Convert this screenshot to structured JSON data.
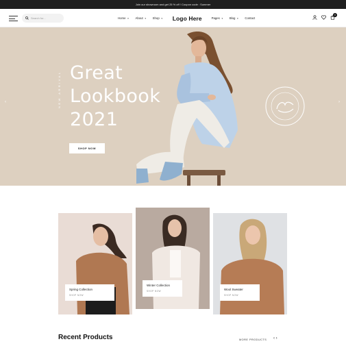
{
  "announcement": "Join our showroom and get 25 % off ! Coupon code : Summer",
  "header": {
    "search_placeholder": "Search for...",
    "nav": [
      {
        "label": "Home"
      },
      {
        "label": "About"
      },
      {
        "label": "Shop"
      },
      {
        "label": "Pages"
      },
      {
        "label": "Blog"
      },
      {
        "label": "Contact"
      }
    ],
    "logo": "Logo Here",
    "cart_count": "0",
    "icons": [
      "menu-icon",
      "search-icon",
      "user-icon",
      "heart-icon",
      "cart-icon"
    ]
  },
  "hero": {
    "title_line1": "Great",
    "title_line2": "Lookbook",
    "title_line3": "2021",
    "vertical_text": "NEW ARRIVAL",
    "button": "SHOP NOW",
    "prev": "‹",
    "next": "›",
    "background": "#ddd0c0"
  },
  "collections": [
    {
      "title": "Spring Collection",
      "sub": "SHOP NOW"
    },
    {
      "title": "Winter Collection",
      "sub": "SHOP NOW"
    },
    {
      "title": "Wool Sweater",
      "sub": "SHOP NOW"
    }
  ],
  "recent": {
    "heading": "Recent Products",
    "more": "MORE PRODUCTS",
    "prev": "‹",
    "next": "›"
  }
}
